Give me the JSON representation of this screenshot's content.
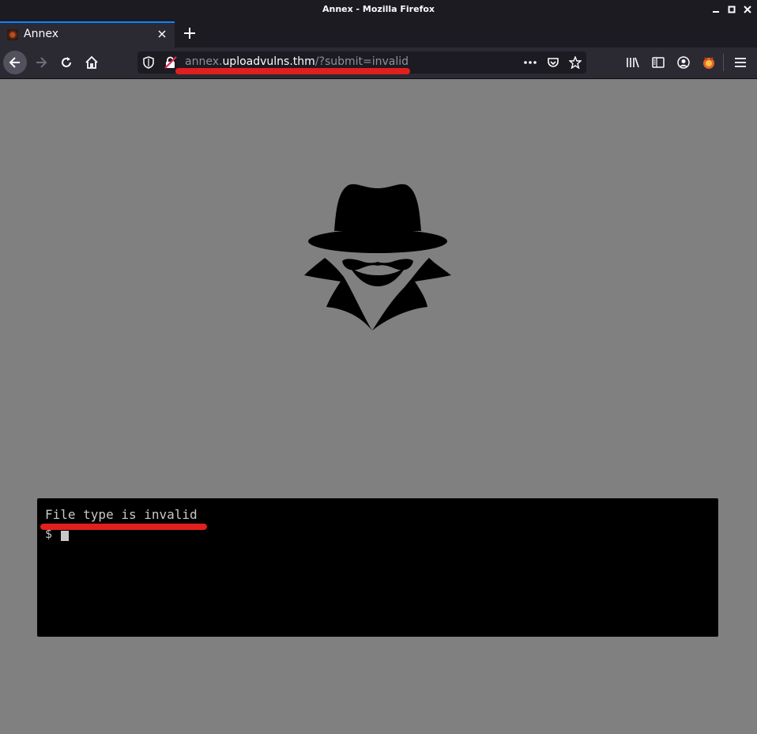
{
  "window": {
    "title": "Annex - Mozilla Firefox"
  },
  "tab": {
    "title": "Annex"
  },
  "urlbar": {
    "subdomain": "annex.",
    "host": "uploadvulns.thm",
    "path": "/?submit=invalid"
  },
  "icons": {
    "back": "arrow-left-icon",
    "forward": "arrow-right-icon",
    "reload": "reload-icon",
    "home": "home-icon",
    "tracking": "shield-icon",
    "insecure": "broken-lock-icon",
    "more": "more-horizontal-icon",
    "pocket": "pocket-icon",
    "bookmark": "star-icon",
    "library": "library-icon",
    "sidebar": "sidebar-icon",
    "account": "account-icon",
    "extension": "extension-icon",
    "menu": "hamburger-menu-icon"
  },
  "terminal": {
    "message": "File type is invalid",
    "prompt": "$"
  },
  "colors": {
    "page_bg": "#808080",
    "terminal_bg": "#000000",
    "annotation": "#e0201e",
    "chrome_dark": "#1c1b22",
    "toolbar": "#2b2a33"
  }
}
